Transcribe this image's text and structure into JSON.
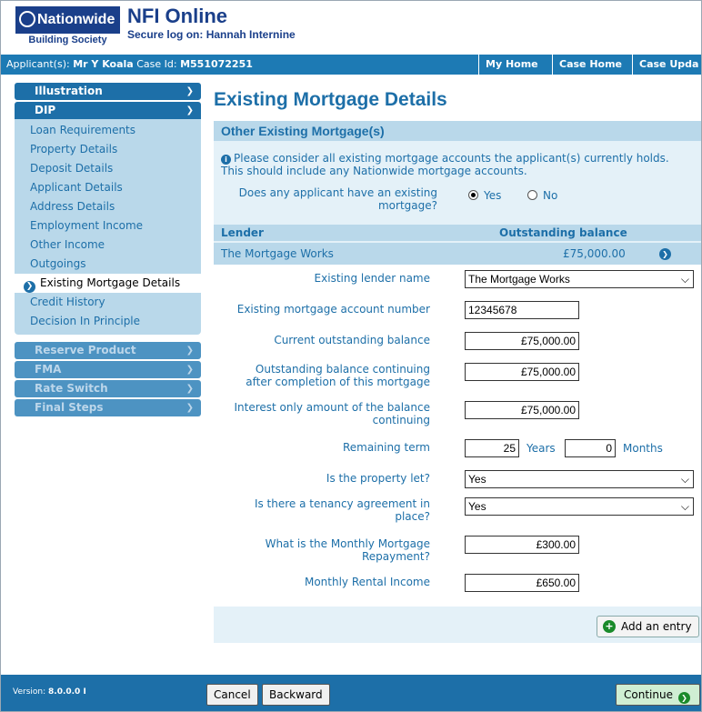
{
  "header": {
    "logo_top": "Nationwide",
    "logo_bottom": "Building Society",
    "app_name": "NFI Online",
    "secure_prefix": "Secure log on:",
    "user": "Hannah Internine"
  },
  "infobar": {
    "applicant_label": "Applicant(s):",
    "applicant": "Mr Y Koala",
    "case_label": "Case Id:",
    "case_id": "M551072251",
    "nav": [
      "My Home",
      "Case Home",
      "Case Upda"
    ]
  },
  "sidebar": {
    "illustration": "Illustration",
    "dip": "DIP",
    "dip_items": [
      "Loan Requirements",
      "Property Details",
      "Deposit Details",
      "Applicant Details",
      "Address Details",
      "Employment Income",
      "Other Income",
      "Outgoings",
      "Existing Mortgage Details",
      "Credit History",
      "Decision In Principle"
    ],
    "other_sections": [
      "Reserve Product",
      "FMA",
      "Rate Switch",
      "Final Steps"
    ]
  },
  "main": {
    "title": "Existing Mortgage Details",
    "section_heading": "Other Existing Mortgage(s)",
    "info_line1": "Please consider all existing mortgage accounts the applicant(s) currently holds.",
    "info_line2": "This should include any Nationwide mortgage accounts.",
    "question_line1": "Does any applicant have an existing",
    "question_line2": "mortgage?",
    "yes": "Yes",
    "no": "No",
    "col_lender": "Lender",
    "col_balance": "Outstanding balance",
    "lender_name": "The Mortgage Works",
    "lender_balance": "£75,000.00"
  },
  "form": {
    "lender_name_label": "Existing lender name",
    "lender_name_value": "The Mortgage Works",
    "account_label": "Existing mortgage account number",
    "account_value": "12345678",
    "current_label": "Current outstanding balance",
    "current_value": "£75,000.00",
    "continuing_label1": "Outstanding balance continuing",
    "continuing_label2": "after completion of this mortgage",
    "continuing_value": "£75,000.00",
    "interest_label1": "Interest only amount of the balance",
    "interest_label2": "continuing",
    "interest_value": "£75,000.00",
    "term_label": "Remaining term",
    "term_years": "25",
    "years": "Years",
    "term_months": "0",
    "months": "Months",
    "let_label": "Is the property let?",
    "let_value": "Yes",
    "tenancy_label1": "Is there a tenancy agreement in",
    "tenancy_label2": "place?",
    "tenancy_value": "Yes",
    "repayment_label1": "What is the Monthly Mortgage",
    "repayment_label2": "Repayment?",
    "repayment_value": "£300.00",
    "rental_label": "Monthly Rental Income",
    "rental_value": "£650.00",
    "add_entry": "Add an entry"
  },
  "footer": {
    "version_label": "Version:",
    "version": "8.0.0.0 I",
    "cancel": "Cancel",
    "backward": "Backward",
    "continue": "Continue"
  }
}
